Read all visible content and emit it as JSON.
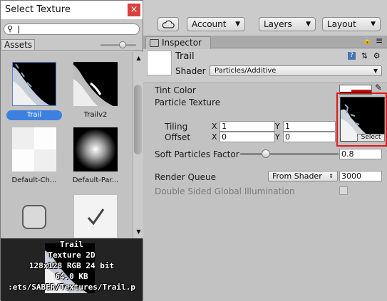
{
  "toolbar": {
    "account_label": "Account",
    "layers_label": "Layers",
    "layout_label": "Layout"
  },
  "inspector": {
    "tab_label": "Inspector",
    "material_name": "Trail",
    "shader_label": "Shader",
    "shader_value": "Particles/Additive",
    "tint_color_label": "Tint Color",
    "particle_texture_label": "Particle Texture",
    "select_label": "Select",
    "tiling_label": "Tiling",
    "offset_label": "Offset",
    "tiling_x": "1",
    "tiling_y": "1",
    "offset_x": "0",
    "offset_y": "0",
    "x_label": "X",
    "y_label": "Y",
    "soft_particles_label": "Soft Particles Factor",
    "soft_particles_value": "0.8",
    "soft_particles_slider_fraction": 0.2,
    "render_queue_label": "Render Queue",
    "render_queue_mode": "From Shader",
    "render_queue_value": "3000",
    "double_sided_gi_label": "Double Sided Global Illumination",
    "double_sided_gi_checked": false
  },
  "picker": {
    "title": "Select Texture",
    "close_glyph": "×",
    "search_value": "",
    "assets_tab": "Assets",
    "items": [
      {
        "label": "Trail",
        "selected": true
      },
      {
        "label": "Trailv2",
        "selected": false
      },
      {
        "label": "Default-Ch...",
        "selected": false
      },
      {
        "label": "Default-Par...",
        "selected": false
      },
      {
        "label": "",
        "selected": false
      },
      {
        "label": "",
        "selected": false
      }
    ],
    "info": {
      "name": "Trail",
      "type": "Texture 2D",
      "format": "128x128  RGB 24 bit",
      "size": "64.0 KB",
      "path": ":ets/SABER/Textures/Trail.p"
    }
  },
  "colors": {
    "selection_blue": "#3d80df",
    "highlight_red": "#e0191c",
    "close_red": "#d9413d"
  }
}
